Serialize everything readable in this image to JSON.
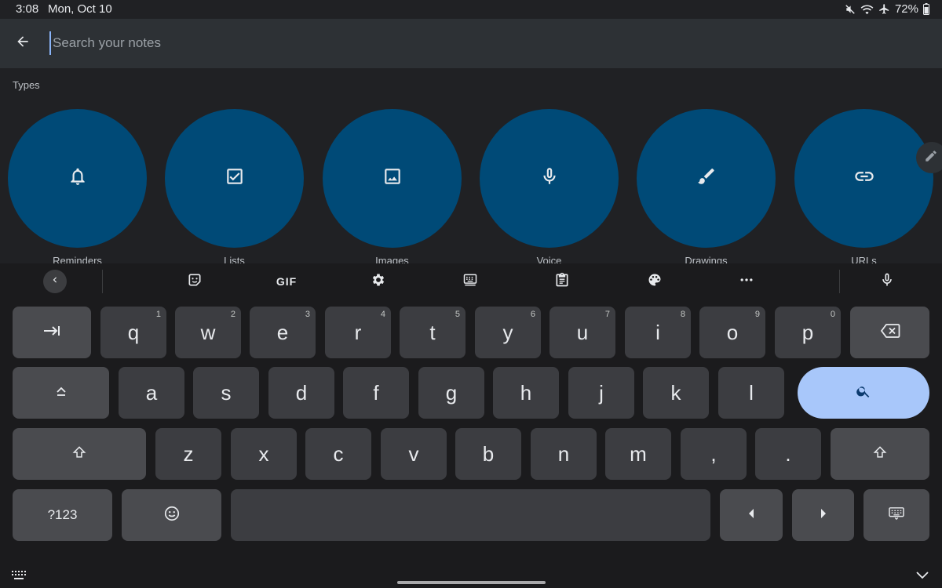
{
  "status_bar": {
    "time": "3:08",
    "date": "Mon, Oct 10",
    "battery": "72%",
    "icons": [
      "mute-icon",
      "wifi-icon",
      "airplane-icon",
      "battery-icon"
    ]
  },
  "search": {
    "placeholder": "Search your notes",
    "value": ""
  },
  "types": {
    "heading": "Types",
    "items": [
      {
        "label": "Reminders",
        "icon": "bell-icon"
      },
      {
        "label": "Lists",
        "icon": "checkbox-icon"
      },
      {
        "label": "Images",
        "icon": "image-icon"
      },
      {
        "label": "Voice",
        "icon": "microphone-icon"
      },
      {
        "label": "Drawings",
        "icon": "brush-icon"
      },
      {
        "label": "URLs",
        "icon": "link-icon"
      }
    ]
  },
  "keyboard": {
    "toolbar": {
      "gif_label": "GIF",
      "icons": [
        "collapse-icon",
        "sticker-icon",
        "gif-icon",
        "settings-icon",
        "keyboard-layout-icon",
        "clipboard-icon",
        "palette-icon",
        "more-icon",
        "microphone-icon"
      ]
    },
    "row1": [
      {
        "ch": "q",
        "num": "1"
      },
      {
        "ch": "w",
        "num": "2"
      },
      {
        "ch": "e",
        "num": "3"
      },
      {
        "ch": "r",
        "num": "4"
      },
      {
        "ch": "t",
        "num": "5"
      },
      {
        "ch": "y",
        "num": "6"
      },
      {
        "ch": "u",
        "num": "7"
      },
      {
        "ch": "i",
        "num": "8"
      },
      {
        "ch": "o",
        "num": "9"
      },
      {
        "ch": "p",
        "num": "0"
      }
    ],
    "row2": [
      "a",
      "s",
      "d",
      "f",
      "g",
      "h",
      "j",
      "k",
      "l"
    ],
    "row3": [
      "z",
      "x",
      "c",
      "v",
      "b",
      "n",
      "m",
      ",",
      "."
    ],
    "symbols_label": "?123",
    "colors": {
      "key": "#3c3d41",
      "fn_key": "#4a4b4f",
      "enter_key": "#a8c7fa",
      "type_tile": "#004a77"
    }
  }
}
